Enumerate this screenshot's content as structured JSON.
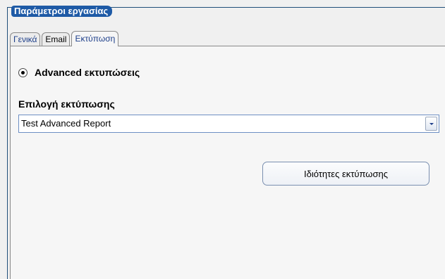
{
  "group": {
    "title": "Παράμετροι εργασίας"
  },
  "tabs": [
    {
      "label": "Γενικά",
      "active": false
    },
    {
      "label": "Email",
      "active": false
    },
    {
      "label": "Εκτύπωση",
      "active": true
    }
  ],
  "print": {
    "radio_label": "Advanced εκτυπώσεις",
    "radio_checked": true,
    "select_label": "Επιλογή εκτύπωσης",
    "select_value": "Test Advanced Report",
    "properties_button_label": "Ιδιότητες εκτύπωσης"
  },
  "colors": {
    "title_background": "#1e5aa6",
    "tab_text": "#1e3f8a",
    "panel_background": "#f6f6f6"
  },
  "icons": {
    "radio": "radio-selected-icon",
    "dropdown": "chevron-down-icon"
  }
}
